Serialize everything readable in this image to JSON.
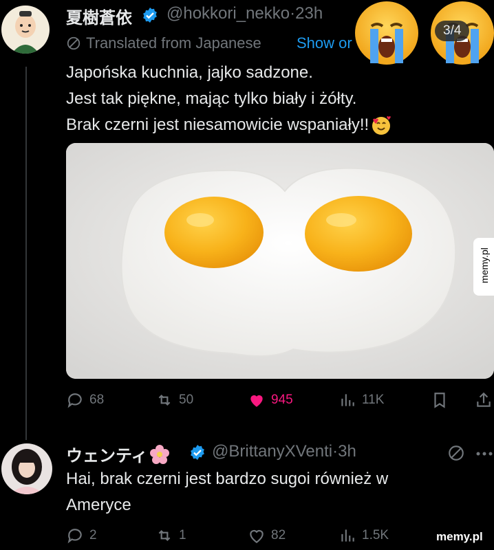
{
  "tweet1": {
    "display_name": "夏樹蒼依",
    "handle": "@hokkori_nekko",
    "dot": "·",
    "time": "23h",
    "translated_label": "Translated from Japanese",
    "show_original": "Show or",
    "text_line1": "Japońska kuchnia, jajko sadzone.",
    "text_line2": "Jest tak piękne, mając tylko biały i żółty.",
    "text_line3": "Brak czerni jest niesamowicie wspaniały!!",
    "image_counter": "3/4",
    "side_watermark": "memy.pl",
    "actions": {
      "replies": "68",
      "reposts": "50",
      "likes": "945",
      "views": "11K"
    }
  },
  "tweet2": {
    "display_name": "ウェンティ",
    "handle": "@BrittanyXVenti",
    "dot": "·",
    "time": "3h",
    "text_line1": "Hai, brak czerni jest bardzo sugoi również w",
    "text_line2": "Ameryce",
    "actions": {
      "replies": "2",
      "reposts": "1",
      "likes": "82",
      "views": "1.5K"
    }
  },
  "watermark": "memy.pl",
  "colors": {
    "like_active": "#f91880",
    "muted": "#71767b",
    "verified": "#1d9bf0"
  }
}
